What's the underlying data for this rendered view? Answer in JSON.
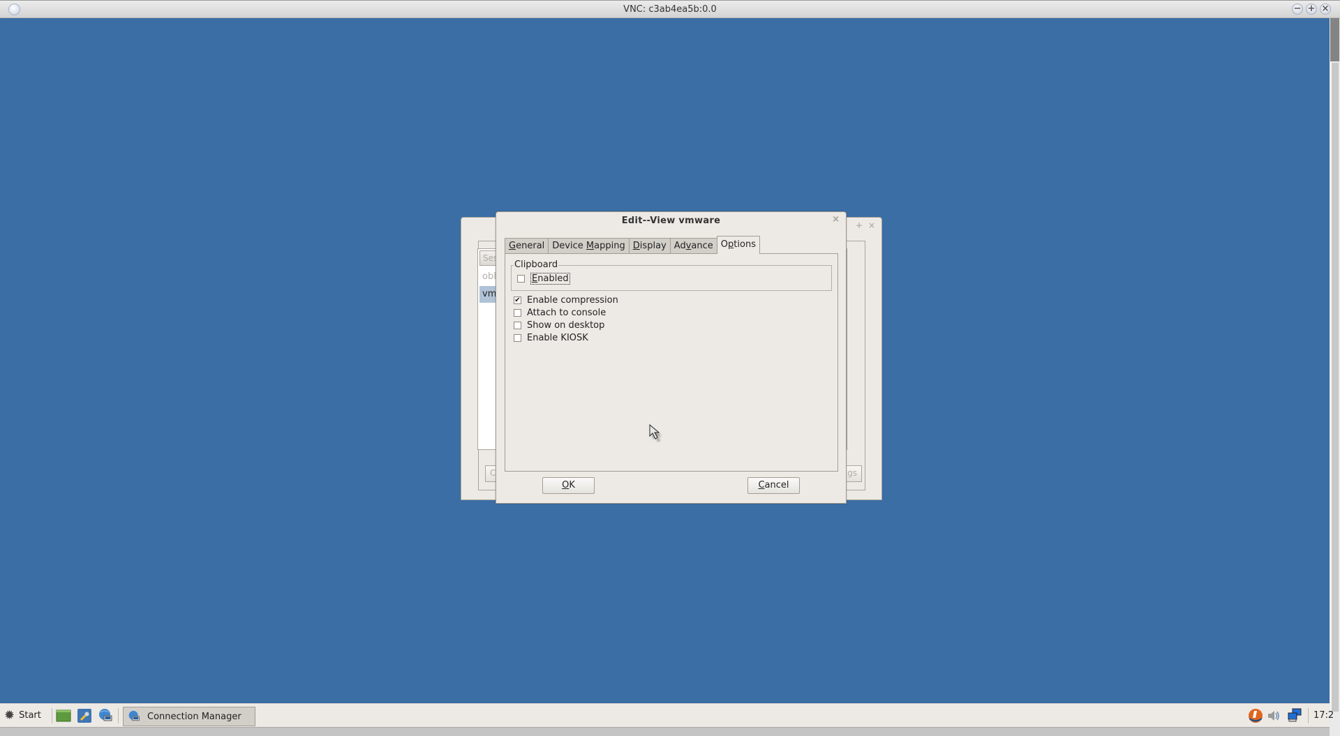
{
  "vnc_window": {
    "title": "VNC: c3ab4ea5b:0.0",
    "controls": {
      "minimize": "−",
      "maximize": "+",
      "close": "×"
    }
  },
  "background_window": {
    "controls": {
      "add": "+",
      "close": "×"
    },
    "list_header": "Ses",
    "rows": [
      {
        "label": "obl",
        "selected": false
      },
      {
        "label": "vmw",
        "selected": true
      }
    ],
    "left_button_label": "C",
    "right_button_label": "gs"
  },
  "dialog": {
    "title": "Edit--View vmware",
    "close_glyph": "×",
    "tabs": [
      {
        "label": "General",
        "mnemonic_index": 0,
        "active": false
      },
      {
        "label": "Device Mapping",
        "mnemonic_index": 7,
        "active": false
      },
      {
        "label": "Display",
        "mnemonic_index": 0,
        "active": false
      },
      {
        "label": "Advance",
        "mnemonic_index": 2,
        "active": false
      },
      {
        "label": "Options",
        "mnemonic_index": 1,
        "active": true
      }
    ],
    "clipboard_group": {
      "legend": "Clipboard",
      "enabled": {
        "label": "Enabled",
        "checked": false
      }
    },
    "options": [
      {
        "label": "Enable compression",
        "checked": true
      },
      {
        "label": "Attach to console",
        "checked": false
      },
      {
        "label": "Show on desktop",
        "checked": false
      },
      {
        "label": "Enable KIOSK",
        "checked": false
      }
    ],
    "ok_label": "OK",
    "cancel_label": "Cancel"
  },
  "taskbar": {
    "start_label": "Start",
    "launchers": [
      "desktop-icon",
      "settings-wrench-icon",
      "network-globe-icon"
    ],
    "task_button_label": "Connection Manager",
    "tray_icons": [
      "update-icon",
      "volume-icon",
      "network-icon"
    ],
    "clock": "17:2"
  },
  "colors": {
    "desktop": "#3a6ea5",
    "dialog_bg": "#edeae5",
    "selected_row": "#b0c2d6"
  }
}
